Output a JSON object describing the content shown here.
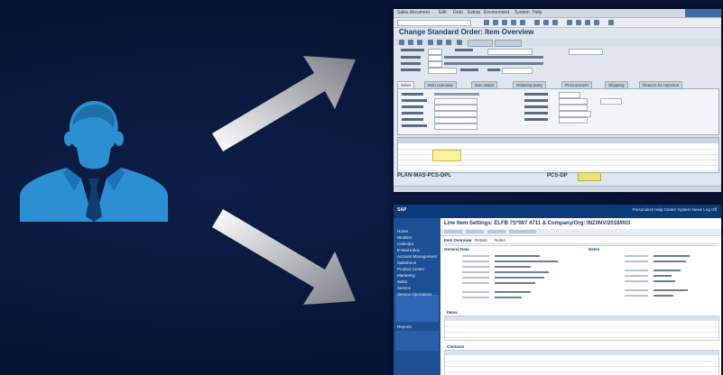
{
  "gui_screen": {
    "menu": [
      "Sales document",
      "Edit",
      "Goto",
      "Extras",
      "Environment",
      "System",
      "Help"
    ],
    "title": "Change Standard Order: Item Overview",
    "tabs": [
      "Sales",
      "Item overview",
      "Item detail",
      "Ordering party",
      "Procurement",
      "Shipping",
      "Reason for rejection"
    ],
    "footer_text": "PLAN-MAS-PCS-DPL",
    "footer_code": "PCS-DP"
  },
  "web_screen": {
    "logo": "SAP",
    "header_links": "Personalize  Help Center  System News  Log Off",
    "page_title": "Line Item Settings: ELFB 7S*007 4711 & Company/Org: INZ/INV/2018/003",
    "tabs": [
      "Item Overview",
      "Details",
      "Notes"
    ],
    "sections": [
      "General Data",
      "Dates",
      "Items",
      "Contacts"
    ],
    "sidebar": [
      "Home",
      "Worklist",
      "Calendar",
      "E-Mail Inbox",
      "Account Management",
      "Salesforce",
      "Product Center",
      "Marketing",
      "Sales",
      "Service",
      "Service Operations",
      "Reports"
    ]
  },
  "colors": {
    "background": "#071433",
    "person": "#2b8fd1",
    "web_header": "#0c3b7a",
    "web_sidebar": "#1c4f93"
  }
}
